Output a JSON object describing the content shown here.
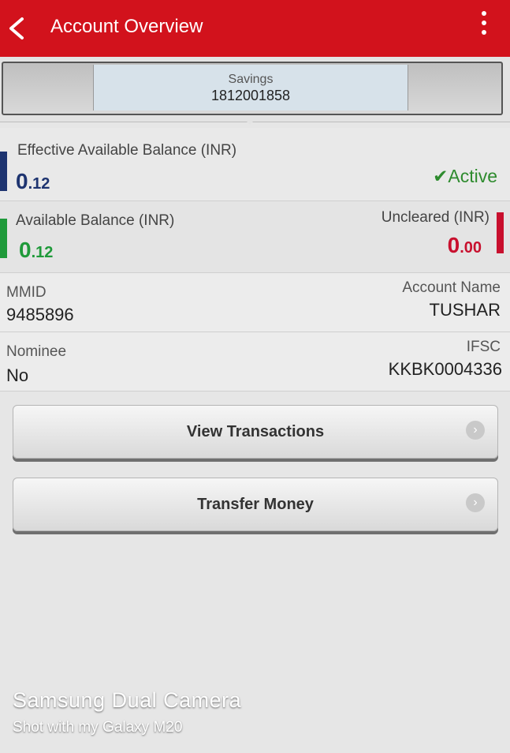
{
  "header": {
    "title": "Account Overview",
    "back_icon": "chevron-left-icon",
    "menu_icon": "more-vertical-icon",
    "color": "#d2121c"
  },
  "account": {
    "type": "Savings",
    "number": "1812001858"
  },
  "balances": {
    "effective_label": "Effective Available Balance (INR)",
    "effective_value_int": "0",
    "effective_value_dec": ".12",
    "status_icon": "check-icon",
    "status": "Active",
    "available_label": "Available Balance (INR)",
    "available_value_int": "0",
    "available_value_dec": ".12",
    "uncleared_label": "Uncleared (INR)",
    "uncleared_value_int": "0",
    "uncleared_value_dec": ".00"
  },
  "details": {
    "mmid_label": "MMID",
    "mmid_value": "9485896",
    "account_name_label": "Account Name",
    "account_name_value": "TUSHAR",
    "nominee_label": "Nominee",
    "nominee_value": "No",
    "ifsc_label": "IFSC",
    "ifsc_value": "KKBK0004336"
  },
  "actions": {
    "view_transactions": "View Transactions",
    "transfer_money": "Transfer Money",
    "chevron_icon": "chevron-right-icon"
  },
  "watermark": {
    "line1": "Samsung Dual Camera",
    "line2": "Shot with my Galaxy M20"
  },
  "colors": {
    "accent_red": "#d2121c",
    "effective_bar": "#1e3470",
    "available_bar": "#1f9a3a",
    "uncleared_bar": "#c8102e",
    "active_green": "#2e8b2e"
  }
}
